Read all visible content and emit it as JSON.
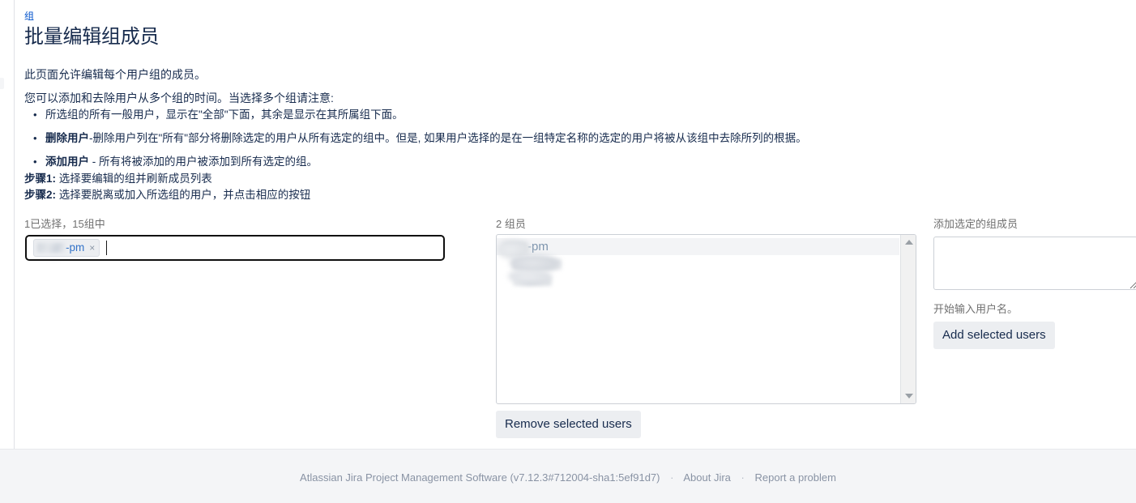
{
  "breadcrumb": {
    "label": "组"
  },
  "page": {
    "title": "批量编辑组成员"
  },
  "description": {
    "line1": "此页面允许编辑每个用户组的成员。",
    "line2": "您可以添加和去除用户从多个组的时间。当选择多个组请注意:",
    "bullets": [
      {
        "bold": "",
        "text": "所选组的所有一般用户，显示在\"全部\"下面，其余是显示在其所属组下面。"
      },
      {
        "bold": "删除用户",
        "text": "-删除用户列在\"所有\"部分将删除选定的用户从所有选定的组中。但是, 如果用户选择的是在一组特定名称的选定的用户将被从该组中去除所列的根据。"
      },
      {
        "bold": "添加用户",
        "text": " - 所有将被添加的用户被添加到所有选定的组。"
      }
    ],
    "steps": [
      {
        "bold": "步骤1:",
        "text": " 选择要编辑的组并刷新成员列表"
      },
      {
        "bold": "步骤2:",
        "text": " 选择要脱离或加入所选组的用户，并点击相应的按钮"
      }
    ]
  },
  "groups_column": {
    "label": "1已选择，15组中",
    "selected_tags": [
      {
        "text": "-pm",
        "remove_label": "×",
        "redacted": true
      }
    ],
    "input_value": ""
  },
  "members_column": {
    "label": "2 组员",
    "rows": [
      {
        "type": "group",
        "text": "-pm",
        "redacted": true,
        "selected": true
      },
      {
        "type": "member",
        "text": "",
        "redacted": true,
        "selected": false
      },
      {
        "type": "member",
        "text": "",
        "redacted": true,
        "selected": false
      }
    ],
    "remove_button_label": "Remove selected users",
    "scrollbar": {
      "up_arrow": "▲",
      "down_arrow": "▼"
    }
  },
  "add_column": {
    "label": "添加选定的组成员",
    "textarea_value": "",
    "textarea_placeholder": "",
    "picker_icon": "users-picker-icon",
    "hint": "开始输入用户名。",
    "add_button_label": "Add selected users"
  },
  "footer": {
    "product": "Atlassian Jira Project Management Software (v7.12.3#712004-sha1:5ef91d7)",
    "separator": "·",
    "links": [
      {
        "label": "About Jira"
      },
      {
        "label": "Report a problem"
      }
    ]
  },
  "colors": {
    "link": "#0052cc",
    "text": "#172b4d",
    "muted": "#707070",
    "page_bg": "#f4f5f7",
    "button_bg": "#eceef1",
    "border": "#ccd0d6",
    "focus_border": "#101010"
  }
}
